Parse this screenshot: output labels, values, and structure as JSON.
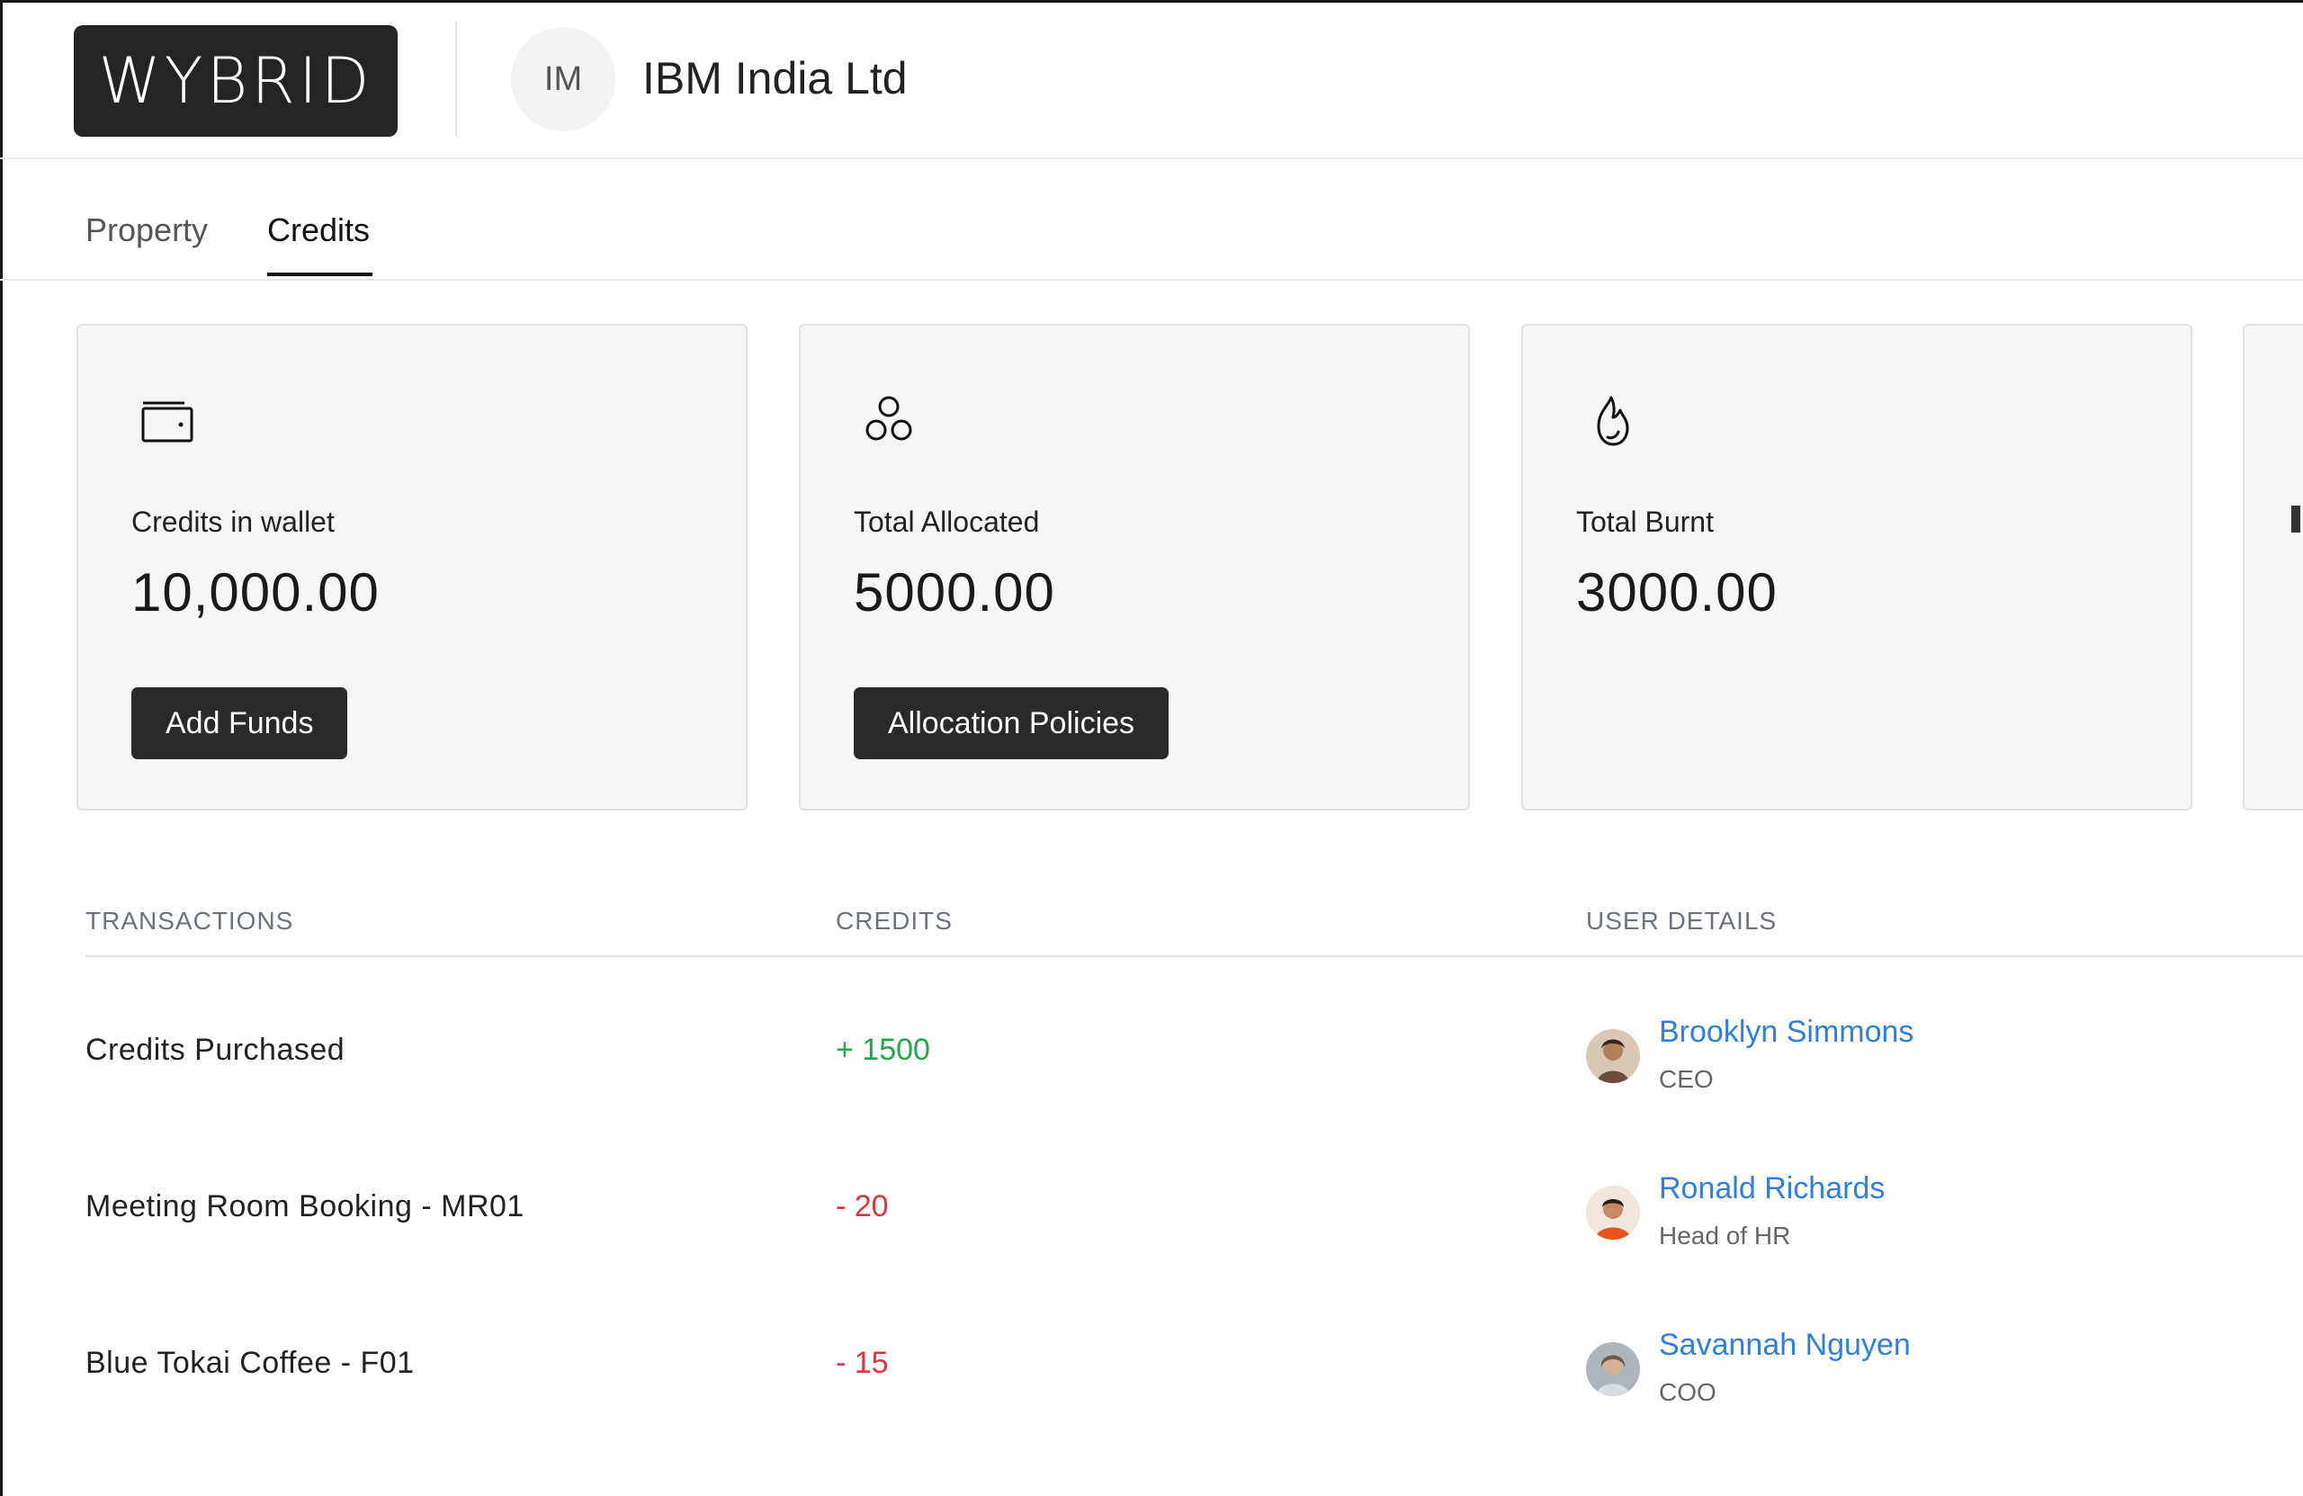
{
  "header": {
    "logo_text": "WYBRID",
    "company_initials": "IM",
    "company_name": "IBM India Ltd"
  },
  "tabs": [
    {
      "label": "Property",
      "active": false
    },
    {
      "label": "Credits",
      "active": true
    }
  ],
  "cards": [
    {
      "icon": "wallet-icon",
      "label": "Credits in wallet",
      "value": "10,000.00",
      "button": "Add Funds"
    },
    {
      "icon": "circles-icon",
      "label": "Total Allocated",
      "value": "5000.00",
      "button": "Allocation Policies"
    },
    {
      "icon": "flame-icon",
      "label": "Total Burnt",
      "value": "3000.00"
    }
  ],
  "table": {
    "headers": [
      "TRANSACTIONS",
      "CREDITS",
      "USER DETAILS"
    ],
    "rows": [
      {
        "transaction": "Credits Purchased",
        "credits": "+ 1500",
        "user_name": "Brooklyn Simmons",
        "user_role": "CEO"
      },
      {
        "transaction": "Meeting Room Booking - MR01",
        "credits": "- 20",
        "user_name": "Ronald Richards",
        "user_role": "Head of HR"
      },
      {
        "transaction": "Blue Tokai Coffee - F01",
        "credits": "- 15",
        "user_name": "Savannah Nguyen",
        "user_role": "COO"
      }
    ]
  },
  "colors": {
    "credit_positive": "#22a84a",
    "credit_negative": "#e3323c",
    "link": "#2f7fe0",
    "button_bg": "#2a2a2a"
  }
}
